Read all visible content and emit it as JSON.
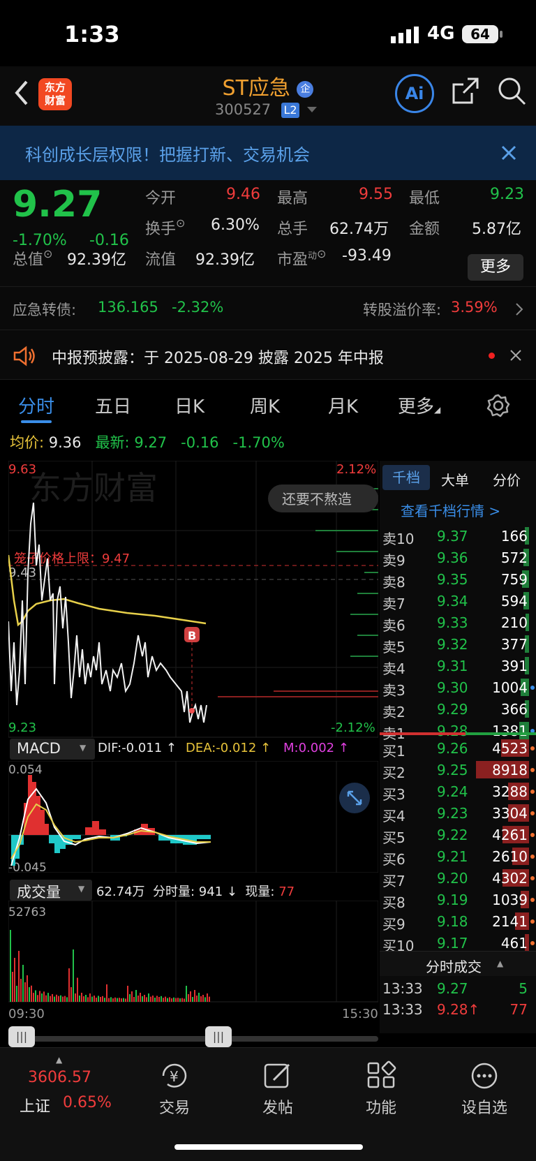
{
  "status": {
    "time": "1:33",
    "network": "4G",
    "battery": "64"
  },
  "header": {
    "name": "ST应急",
    "code": "300527",
    "level": "L2",
    "badge": "企",
    "logo_line1": "东方",
    "logo_line2": "财富",
    "ai_label": "Ai"
  },
  "banner": {
    "text": "科创成长层权限！把握打新、交易机会"
  },
  "quote": {
    "price": "9.27",
    "change_pct": "-1.70%",
    "change": "-0.16",
    "open_label": "今开",
    "open": "9.46",
    "high_label": "最高",
    "high": "9.55",
    "low_label": "最低",
    "low": "9.23",
    "turnover_label": "换手",
    "turnover": "6.30%",
    "volume_label": "总手",
    "volume": "62.74万",
    "amount_label": "金额",
    "amount": "5.87亿",
    "mktcap_label": "总值",
    "mktcap": "92.39亿",
    "float_label": "流值",
    "float": "92.39亿",
    "pe_label": "市盈",
    "pe_sup": "动",
    "pe": "-93.49",
    "more": "更多"
  },
  "convertible": {
    "label": "应急转债:",
    "price": "136.165",
    "pct": "-2.32%",
    "premium_label": "转股溢价率:",
    "premium": "3.59%"
  },
  "notice": {
    "text": "中报预披露：于 2025-08-29 披露 2025 年中报"
  },
  "tabs": [
    "分时",
    "五日",
    "日K",
    "周K",
    "月K",
    "更多"
  ],
  "chart_info": {
    "avg_label": "均价:",
    "avg": "9.36",
    "last_label": "最新:",
    "last": "9.27",
    "chg": "-0.16",
    "pct": "-1.70%"
  },
  "chart": {
    "ymax": "9.63",
    "ymin": "9.23",
    "pct_top": "2.12%",
    "pct_bottom": "-2.12%",
    "prev_close": "9.43",
    "limit_label": "笼子价格上限：9.47",
    "tooltip": "还要不熬造",
    "watermark": "东方财富",
    "marker": "B"
  },
  "macd": {
    "title": "MACD",
    "dif": "DIF:-0.011 ↑",
    "dea": "DEA:-0.012 ↑",
    "m": "M:0.002 ↑",
    "top": "0.054",
    "bottom": "-0.045"
  },
  "volume_panel": {
    "title": "成交量",
    "total": "62.74万",
    "tick_label": "分时量:",
    "tick": "941 ↓",
    "now_label": "现量:",
    "now": "77",
    "top": "52763",
    "start": "09:30",
    "end": "15:30"
  },
  "book": {
    "tabs": [
      "千档",
      "大单",
      "分价"
    ],
    "link": "查看千档行情 >",
    "asks": [
      {
        "l": "卖10",
        "p": "9.37",
        "v": "166",
        "w": 6
      },
      {
        "l": "卖9",
        "p": "9.36",
        "v": "572",
        "w": 8
      },
      {
        "l": "卖8",
        "p": "9.35",
        "v": "759",
        "w": 10
      },
      {
        "l": "卖7",
        "p": "9.34",
        "v": "594",
        "w": 8
      },
      {
        "l": "卖6",
        "p": "9.33",
        "v": "210",
        "w": 5
      },
      {
        "l": "卖5",
        "p": "9.32",
        "v": "377",
        "w": 6
      },
      {
        "l": "卖4",
        "p": "9.31",
        "v": "391",
        "w": 6
      },
      {
        "l": "卖3",
        "p": "9.30",
        "v": "1004",
        "w": 12
      },
      {
        "l": "卖2",
        "p": "9.29",
        "v": "366",
        "w": 6
      },
      {
        "l": "卖1",
        "p": "9.28",
        "v": "1381",
        "w": 14
      }
    ],
    "bids": [
      {
        "l": "买1",
        "p": "9.26",
        "v": "4523",
        "w": 40
      },
      {
        "l": "买2",
        "p": "9.25",
        "v": "8918",
        "w": 76
      },
      {
        "l": "买3",
        "p": "9.24",
        "v": "3288",
        "w": 30
      },
      {
        "l": "买4",
        "p": "9.23",
        "v": "3304",
        "w": 30
      },
      {
        "l": "买5",
        "p": "9.22",
        "v": "4261",
        "w": 38
      },
      {
        "l": "买6",
        "p": "9.21",
        "v": "2610",
        "w": 24
      },
      {
        "l": "买7",
        "p": "9.20",
        "v": "4302",
        "w": 38
      },
      {
        "l": "买8",
        "p": "9.19",
        "v": "1039",
        "w": 12
      },
      {
        "l": "买9",
        "p": "9.18",
        "v": "2141",
        "w": 20
      },
      {
        "l": "买10",
        "p": "9.17",
        "v": "461",
        "w": 6
      }
    ],
    "trades_title": "分时成交",
    "trades": [
      {
        "t": "13:33",
        "p": "9.27",
        "v": "5"
      },
      {
        "t": "13:33",
        "p": "9.28↑",
        "v": "77"
      }
    ]
  },
  "nav": {
    "index_value": "3606.57",
    "index_name": "上证",
    "index_pct": "0.65%",
    "items": [
      "交易",
      "发帖",
      "功能",
      "设自选"
    ]
  }
}
